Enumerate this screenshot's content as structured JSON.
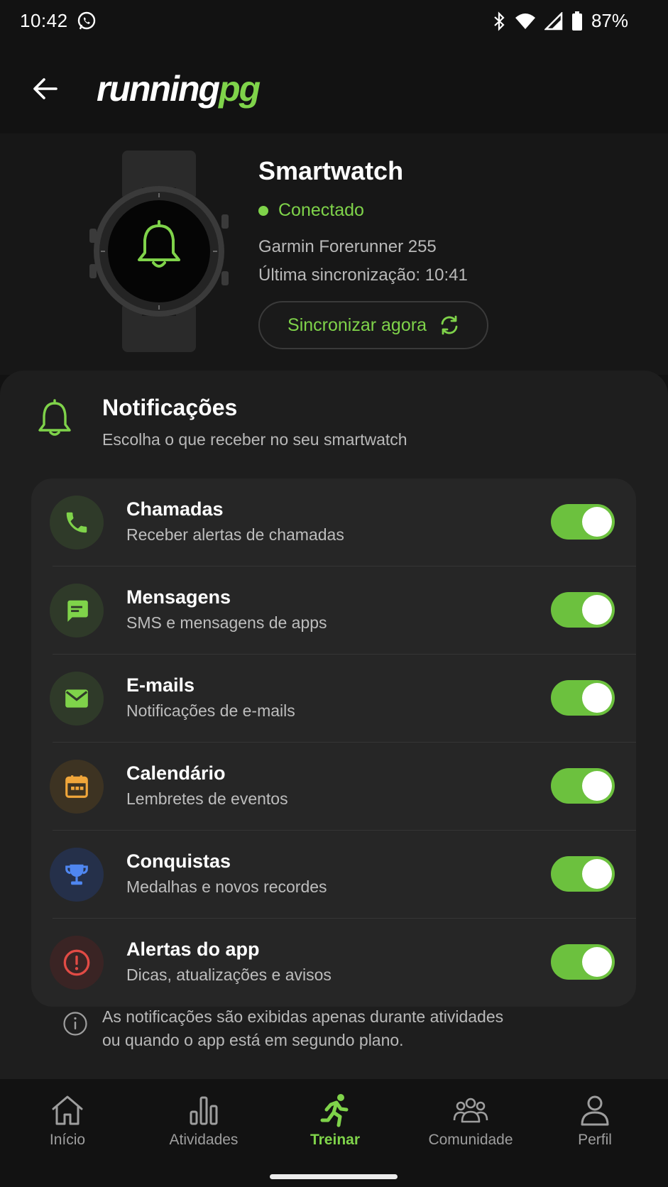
{
  "status_bar": {
    "time": "10:42",
    "battery": "87%",
    "icons": [
      "whatsapp-icon",
      "bluetooth-icon",
      "wifi-icon",
      "signal-icon",
      "battery-icon"
    ]
  },
  "header": {
    "back_icon": "arrow-left-icon",
    "logo_part1": "running",
    "logo_part2": "pg"
  },
  "device": {
    "title": "Smartwatch",
    "status": "Conectado",
    "model": "Garmin Forerunner 255",
    "last_sync": "Última sincronização: 10:41",
    "sync_button": "Sincronizar agora"
  },
  "notifications": {
    "title": "Notificações",
    "subtitle": "Escolha o que receber no seu smartwatch",
    "items": [
      {
        "title": "Chamadas",
        "subtitle": "Receber alertas de chamadas",
        "icon": "phone-icon",
        "enabled": true
      },
      {
        "title": "Mensagens",
        "subtitle": "SMS e mensagens de apps",
        "icon": "message-icon",
        "enabled": true
      },
      {
        "title": "E-mails",
        "subtitle": "Notificações de e-mails",
        "icon": "mail-icon",
        "enabled": true
      },
      {
        "title": "Calendário",
        "subtitle": "Lembretes de eventos",
        "icon": "calendar-icon",
        "enabled": true
      },
      {
        "title": "Conquistas",
        "subtitle": "Medalhas e novos recordes",
        "icon": "trophy-icon",
        "enabled": true
      },
      {
        "title": "Alertas do app",
        "subtitle": "Dicas, atualizações e avisos",
        "icon": "alert-icon",
        "enabled": true
      }
    ],
    "info_line1": "As notificações são exibidas apenas durante atividades",
    "info_line2": "ou quando o app está em segundo plano."
  },
  "nav": {
    "items": [
      {
        "label": "Início",
        "icon": "home-icon"
      },
      {
        "label": "Atividades",
        "icon": "bar-chart-icon"
      },
      {
        "label": "Treinar",
        "icon": "runner-icon",
        "active": true
      },
      {
        "label": "Comunidade",
        "icon": "community-icon"
      },
      {
        "label": "Perfil",
        "icon": "profile-icon"
      }
    ]
  },
  "colors": {
    "accent": "#7fd34a",
    "toggle_on": "#6cc13e",
    "background": "#121212",
    "panel": "#1e1e1e",
    "card": "#262626"
  }
}
